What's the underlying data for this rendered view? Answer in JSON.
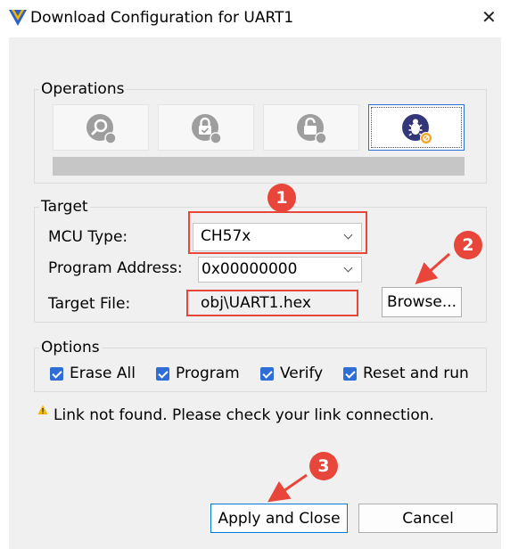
{
  "window": {
    "title": "Download Configuration for UART1"
  },
  "operations": {
    "legend": "Operations",
    "buttons": [
      {
        "icon": "query-icon",
        "selected": false
      },
      {
        "icon": "lock-icon",
        "selected": false
      },
      {
        "icon": "unlock-icon",
        "selected": false
      },
      {
        "icon": "debug-bug-icon",
        "selected": true
      }
    ],
    "progress": 0
  },
  "target": {
    "legend": "Target",
    "mcu_label": "MCU Type:",
    "mcu_value": "CH57x",
    "address_label": "Program Address:",
    "address_value": "0x00000000",
    "file_label": "Target File:",
    "file_value": "obj\\UART1.hex",
    "browse_label": "Browse..."
  },
  "options": {
    "legend": "Options",
    "erase_all": "Erase All",
    "program": "Program",
    "verify": "Verify",
    "reset_and_run": "Reset and run"
  },
  "status": {
    "text": "Link not found. Please check your link connection."
  },
  "buttons": {
    "apply": "Apply and Close",
    "cancel": "Cancel"
  },
  "annotations": {
    "step1": "1",
    "step2": "2",
    "step3": "3"
  },
  "colors": {
    "accent": "#2e6ed6",
    "annotation": "#e8463a",
    "warning": "#f2b900"
  }
}
